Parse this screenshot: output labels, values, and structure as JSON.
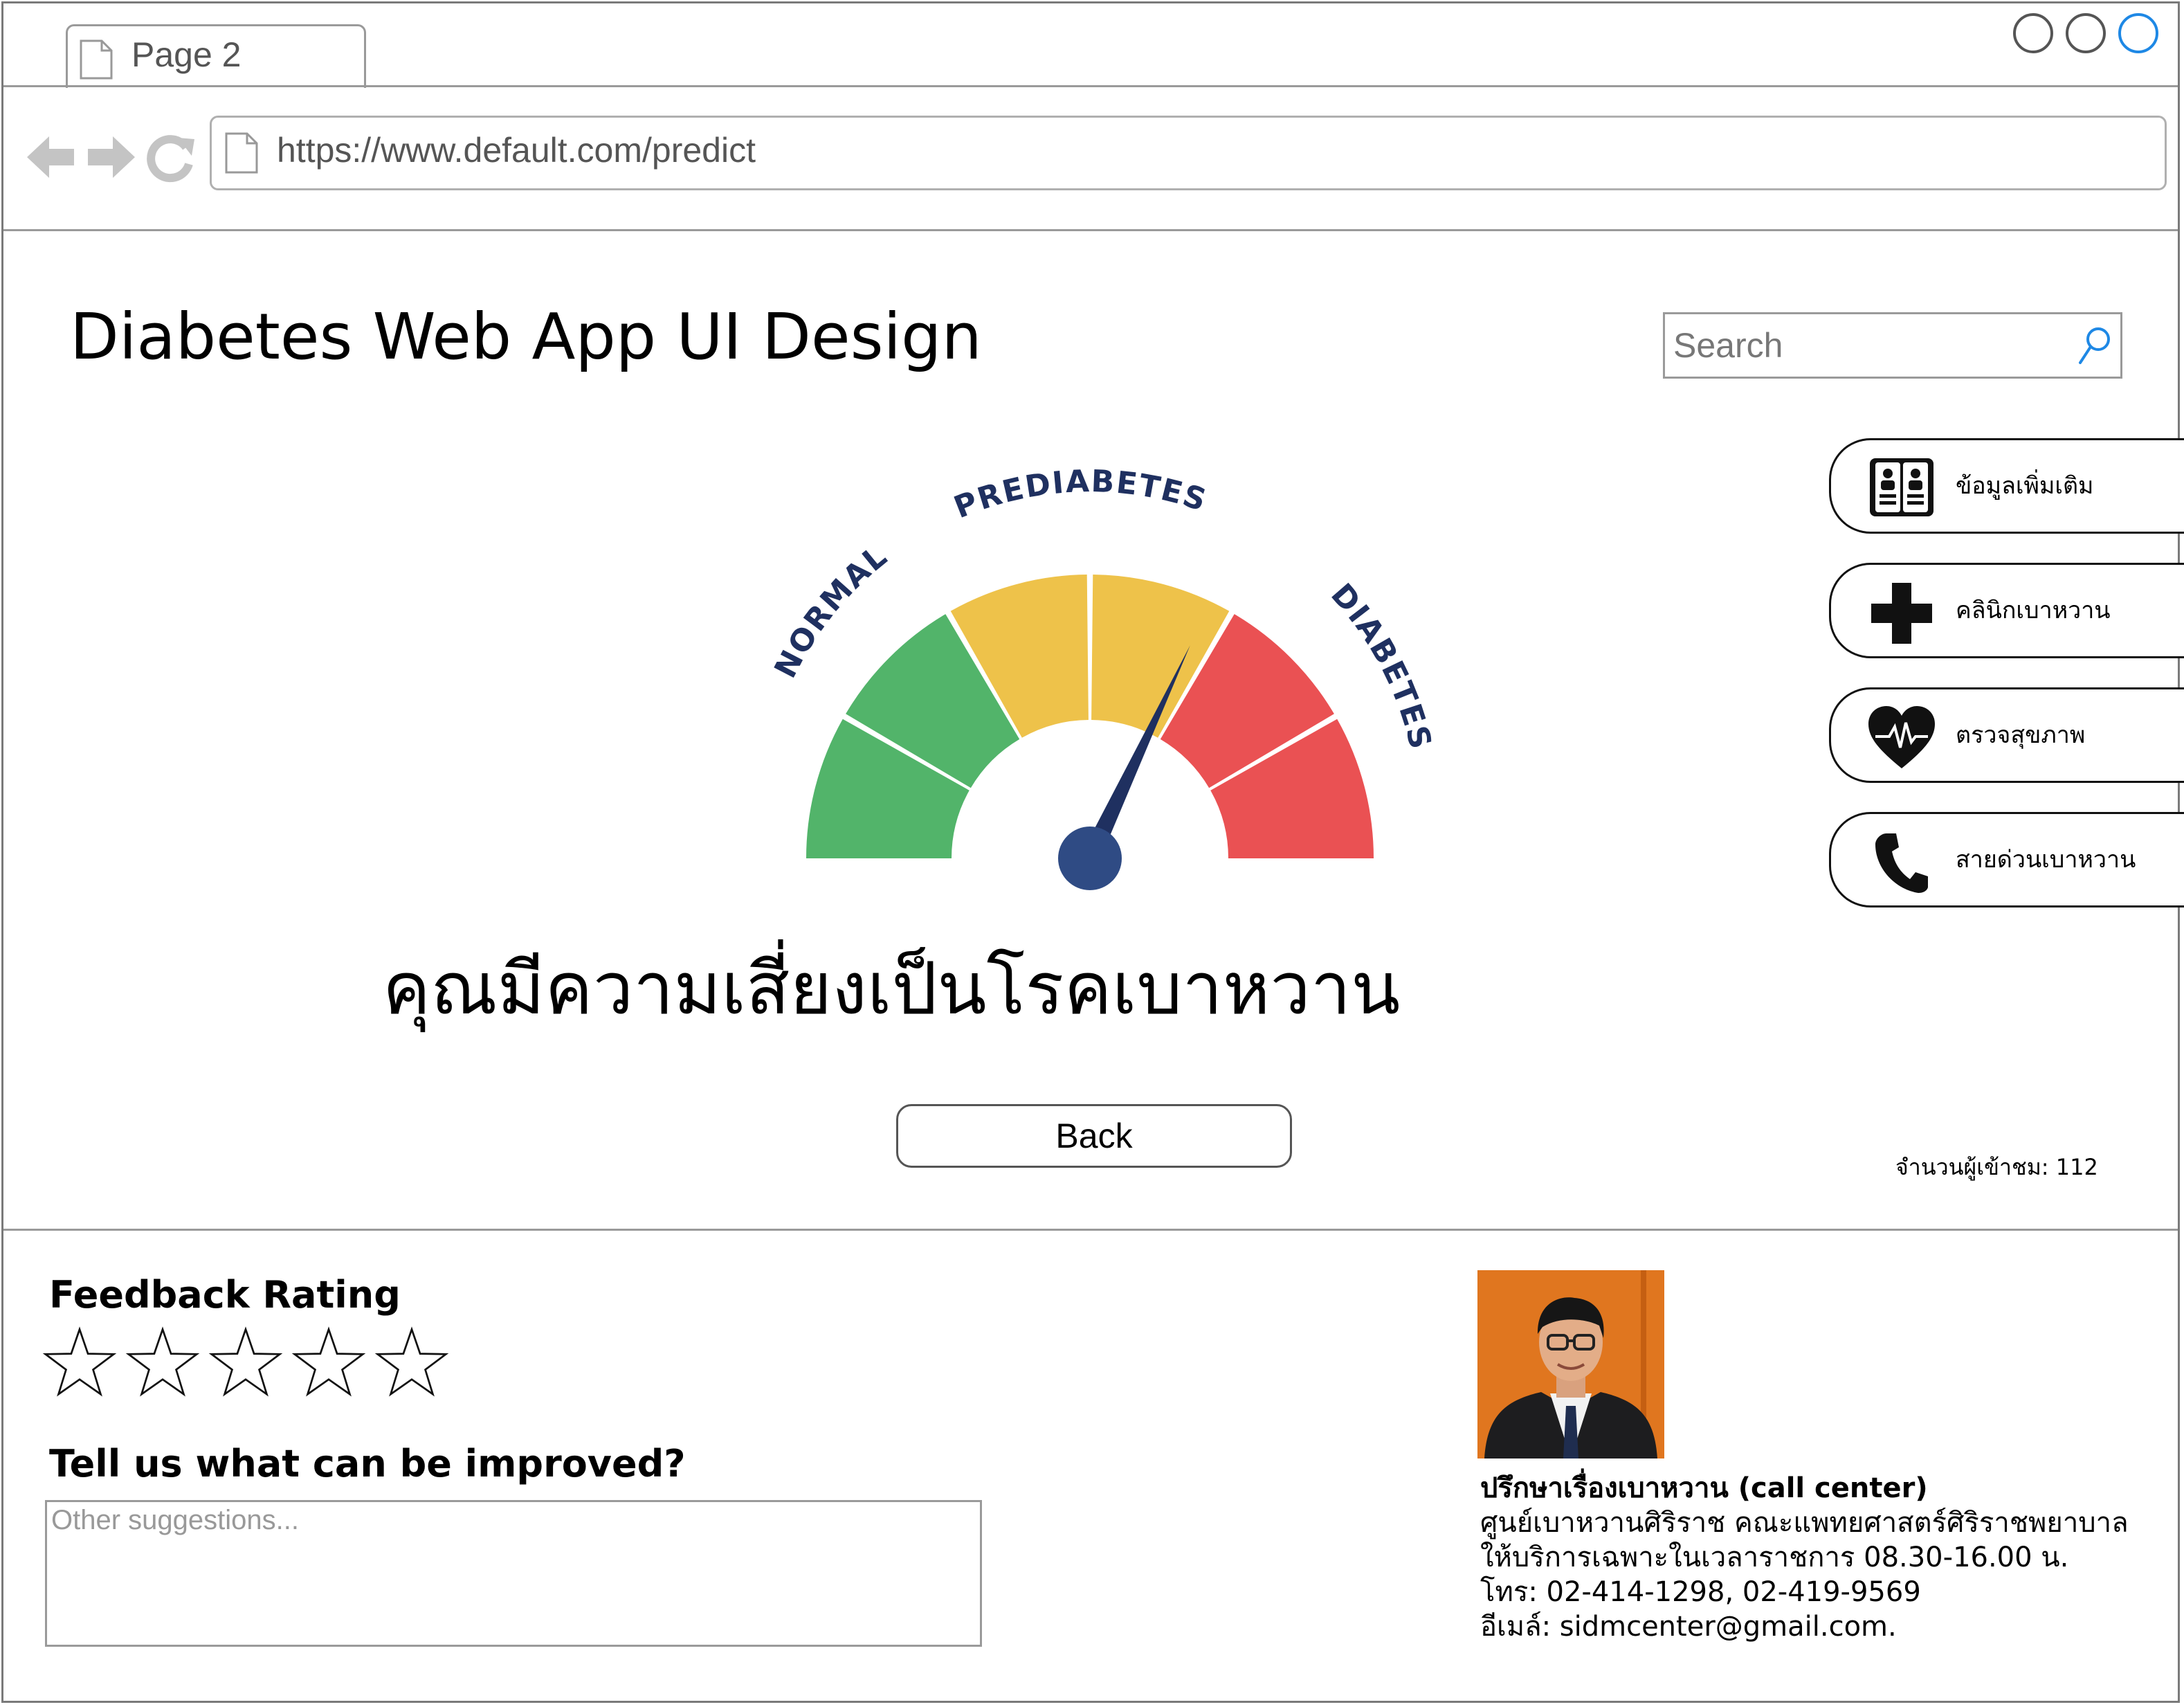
{
  "browser": {
    "tab_title": "Page 2",
    "url": "https://www.default.com/predict"
  },
  "header": {
    "title": "Diabetes Web App UI Design",
    "search_placeholder": "Search"
  },
  "gauge": {
    "labels": [
      "NORMAL",
      "PREDIABETES",
      "DIABETES"
    ],
    "level": 0.64,
    "colors": {
      "normal": "#52b46a",
      "prediabetes": "#eec24a",
      "diabetes": "#ea5153",
      "needle": "#1f3060",
      "hub": "#2f4b84"
    }
  },
  "result": {
    "message": "คุณมีความเสี่ยงเป็นโรคเบาหวาน"
  },
  "actions": {
    "back_label": "Back"
  },
  "sidebar": {
    "items": [
      {
        "label": "ข้อมูลเพิ่มเติม",
        "icon": "book-icon"
      },
      {
        "label": "คลินิกเบาหวาน",
        "icon": "medical-cross-icon"
      },
      {
        "label": "ตรวจสุขภาพ",
        "icon": "heart-pulse-icon"
      },
      {
        "label": "สายด่วนเบาหวาน",
        "icon": "phone-icon"
      }
    ]
  },
  "visitors": {
    "text": "จำนวนผู้เข้าชม: 112"
  },
  "feedback": {
    "title": "Feedback Rating",
    "rating": 0,
    "max_rating": 5,
    "improve_title": "Tell us what can be improved?",
    "suggestion_placeholder": "Other suggestions..."
  },
  "contact": {
    "title": "ปรึกษาเรื่องเบาหวาน (call center)",
    "line1": "ศูนย์เบาหวานศิริราช คณะแพทยศาสตร์ศิริราชพยาบาล",
    "line2": "ให้บริการเฉพาะในเวลาราชการ 08.30-16.00 น.",
    "line3": "โทร: 02-414-1298, 02-419-9569",
    "line4": "อีเมล์: sidmcenter@gmail.com."
  }
}
